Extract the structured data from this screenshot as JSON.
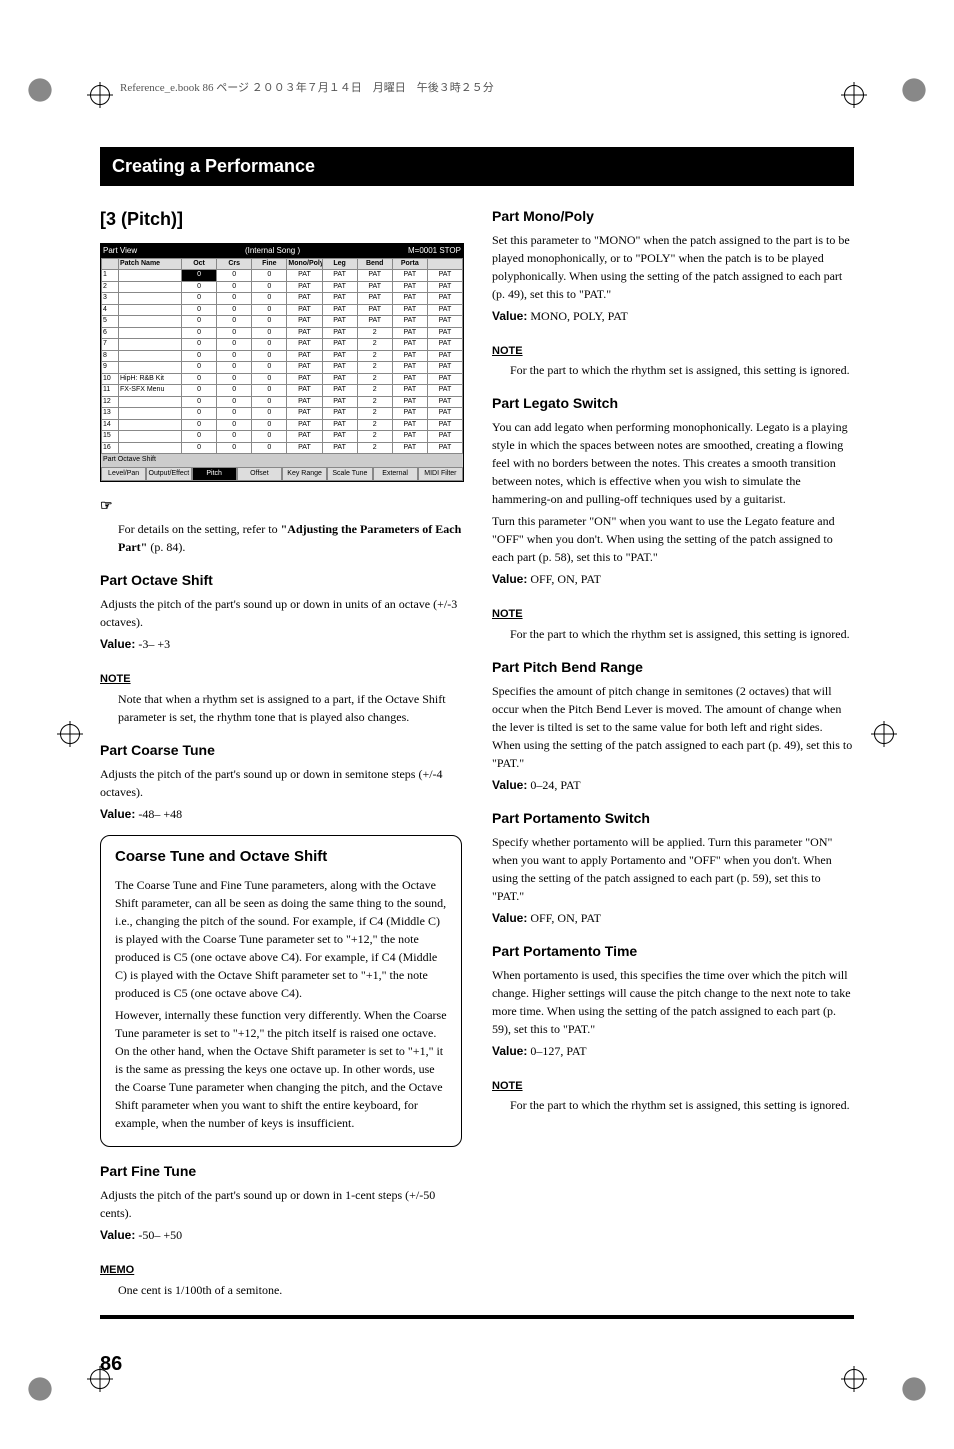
{
  "print_header": "Reference_e.book 86 ページ ２００３年７月１４日　月曜日　午後３時２５分",
  "chapter_header": "Creating a Performance",
  "page_number": "86",
  "left": {
    "section_title": "[3 (Pitch)]",
    "lcd": {
      "title_left": "Part View",
      "title_mid": "(Internal Song )",
      "title_right": "M=0001  STOP",
      "headers": [
        "",
        "Patch Name",
        "Oct",
        "Crs",
        "Fine",
        "Mono/Poly",
        "Leg",
        "Bend",
        "Porta",
        ""
      ],
      "rows": [
        [
          "1",
          "",
          "0",
          "0",
          "0",
          "PAT",
          "PAT",
          "PAT",
          "PAT",
          "PAT"
        ],
        [
          "2",
          "",
          "0",
          "0",
          "0",
          "PAT",
          "PAT",
          "PAT",
          "PAT",
          "PAT"
        ],
        [
          "3",
          "",
          "0",
          "0",
          "0",
          "PAT",
          "PAT",
          "PAT",
          "PAT",
          "PAT"
        ],
        [
          "4",
          "",
          "0",
          "0",
          "0",
          "PAT",
          "PAT",
          "PAT",
          "PAT",
          "PAT"
        ],
        [
          "5",
          "",
          "0",
          "0",
          "0",
          "PAT",
          "PAT",
          "PAT",
          "PAT",
          "PAT"
        ],
        [
          "6",
          "",
          "0",
          "0",
          "0",
          "PAT",
          "PAT",
          "2",
          "PAT",
          "PAT"
        ],
        [
          "7",
          "",
          "0",
          "0",
          "0",
          "PAT",
          "PAT",
          "2",
          "PAT",
          "PAT"
        ],
        [
          "8",
          "",
          "0",
          "0",
          "0",
          "PAT",
          "PAT",
          "2",
          "PAT",
          "PAT"
        ],
        [
          "9",
          "",
          "0",
          "0",
          "0",
          "PAT",
          "PAT",
          "2",
          "PAT",
          "PAT"
        ],
        [
          "10",
          "HipH: R&B Kit",
          "0",
          "0",
          "0",
          "PAT",
          "PAT",
          "2",
          "PAT",
          "PAT"
        ],
        [
          "11",
          "FX-SFX Menu",
          "0",
          "0",
          "0",
          "PAT",
          "PAT",
          "2",
          "PAT",
          "PAT"
        ],
        [
          "12",
          "",
          "0",
          "0",
          "0",
          "PAT",
          "PAT",
          "2",
          "PAT",
          "PAT"
        ],
        [
          "13",
          "",
          "0",
          "0",
          "0",
          "PAT",
          "PAT",
          "2",
          "PAT",
          "PAT"
        ],
        [
          "14",
          "",
          "0",
          "0",
          "0",
          "PAT",
          "PAT",
          "2",
          "PAT",
          "PAT"
        ],
        [
          "15",
          "",
          "0",
          "0",
          "0",
          "PAT",
          "PAT",
          "2",
          "PAT",
          "PAT"
        ],
        [
          "16",
          "",
          "0",
          "0",
          "0",
          "PAT",
          "PAT",
          "2",
          "PAT",
          "PAT"
        ]
      ],
      "footer": "Part Octave Shift",
      "tabs": [
        "Level/Pan",
        "Output/Effect",
        "Pitch",
        "Offset",
        "Key Range",
        "Scale Tune",
        "External",
        "MIDI Filter"
      ],
      "active_tab": 2
    },
    "hint_body": "For details on the setting, refer to ",
    "hint_bold": "\"Adjusting the Parameters of Each Part\"",
    "hint_tail": " (p. 84).",
    "octave": {
      "h": "Part Octave Shift",
      "p": "Adjusts the pitch of the part's sound up or down in units of an octave (+/-3 octaves).",
      "vlabel": "Value:",
      "v": " -3– +3",
      "note_label": "NOTE",
      "note": "Note that when a rhythm set is assigned to a part, if the Octave Shift parameter is set, the rhythm tone that is played also changes."
    },
    "coarse": {
      "h": "Part Coarse Tune",
      "p": "Adjusts the pitch of the part's sound up or down in semitone steps (+/-4 octaves).",
      "vlabel": "Value:",
      "v": " -48– +48"
    },
    "callout": {
      "h": "Coarse Tune and Octave Shift",
      "p1": "The Coarse Tune and Fine Tune parameters, along with the Octave Shift parameter, can all be seen as doing the same thing to the sound, i.e., changing the pitch of the sound. For example, if C4 (Middle C) is played with the Coarse Tune parameter set to \"+12,\" the note produced is C5 (one octave above C4). For example, if C4 (Middle C) is played with the Octave Shift parameter set to \"+1,\" the note produced is C5 (one octave above C4).",
      "p2": "However, internally these function very differently. When the Coarse Tune parameter is set to \"+12,\" the pitch itself is raised one octave. On the other hand, when the Octave Shift parameter is set to \"+1,\" it is the same as pressing the keys one octave up. In other words, use the Coarse Tune parameter when changing the pitch, and the Octave Shift parameter when you want to shift the entire keyboard, for example, when the number of keys is insufficient."
    },
    "fine": {
      "h": "Part Fine Tune",
      "p": "Adjusts the pitch of the part's sound up or down in 1-cent steps (+/-50 cents).",
      "vlabel": "Value:",
      "v": " -50– +50",
      "memo_label": "MEMO",
      "memo": "One cent is 1/100th of a semitone."
    }
  },
  "right": {
    "mono": {
      "h": "Part Mono/Poly",
      "p": "Set this parameter to \"MONO\" when the patch assigned to the part is to be played monophonically, or to \"POLY\" when the patch is to be played polyphonically. When using the setting of the patch assigned to each part (p. 49), set this to \"PAT.\"",
      "vlabel": "Value:",
      "v": " MONO, POLY, PAT",
      "note_label": "NOTE",
      "note": "For the part to which the rhythm set is assigned, this setting is ignored."
    },
    "legato": {
      "h": "Part Legato Switch",
      "p1": "You can add legato when performing monophonically. Legato is a playing style in which the spaces between notes are smoothed, creating a flowing feel with no borders between the notes. This creates a smooth transition between notes, which is effective when you wish to simulate the hammering-on and pulling-off techniques used by a guitarist.",
      "p2": "Turn this parameter \"ON\" when you want to use the Legato feature and \"OFF\" when you don't. When using the setting of the patch assigned to each part (p. 58), set this to \"PAT.\"",
      "vlabel": "Value:",
      "v": " OFF, ON, PAT",
      "note_label": "NOTE",
      "note": "For the part to which the rhythm set is assigned, this setting is ignored."
    },
    "bend": {
      "h": "Part Pitch Bend Range",
      "p": "Specifies the amount of pitch change in semitones (2 octaves) that will occur when the Pitch Bend Lever is moved. The amount of change when the lever is tilted is set to the same value for both left and right sides. When using the setting of the patch assigned to each part (p. 49), set this to \"PAT.\"",
      "vlabel": "Value:",
      "v": " 0–24, PAT"
    },
    "portsw": {
      "h": "Part Portamento Switch",
      "p": "Specify whether portamento will be applied. Turn this parameter \"ON\" when you want to apply Portamento and \"OFF\" when you don't. When using the setting of the patch assigned to each part (p. 59), set this to \"PAT.\"",
      "vlabel": "Value:",
      "v": " OFF, ON, PAT"
    },
    "porttime": {
      "h": "Part Portamento Time",
      "p": "When portamento is used, this specifies the time over which the pitch will change. Higher settings will cause the pitch change to the next note to take more time. When using the setting of the patch assigned to each part (p. 59), set this to \"PAT.\"",
      "vlabel": "Value:",
      "v": " 0–127, PAT",
      "note_label": "NOTE",
      "note": "For the part to which the rhythm set is assigned, this setting is ignored."
    }
  }
}
